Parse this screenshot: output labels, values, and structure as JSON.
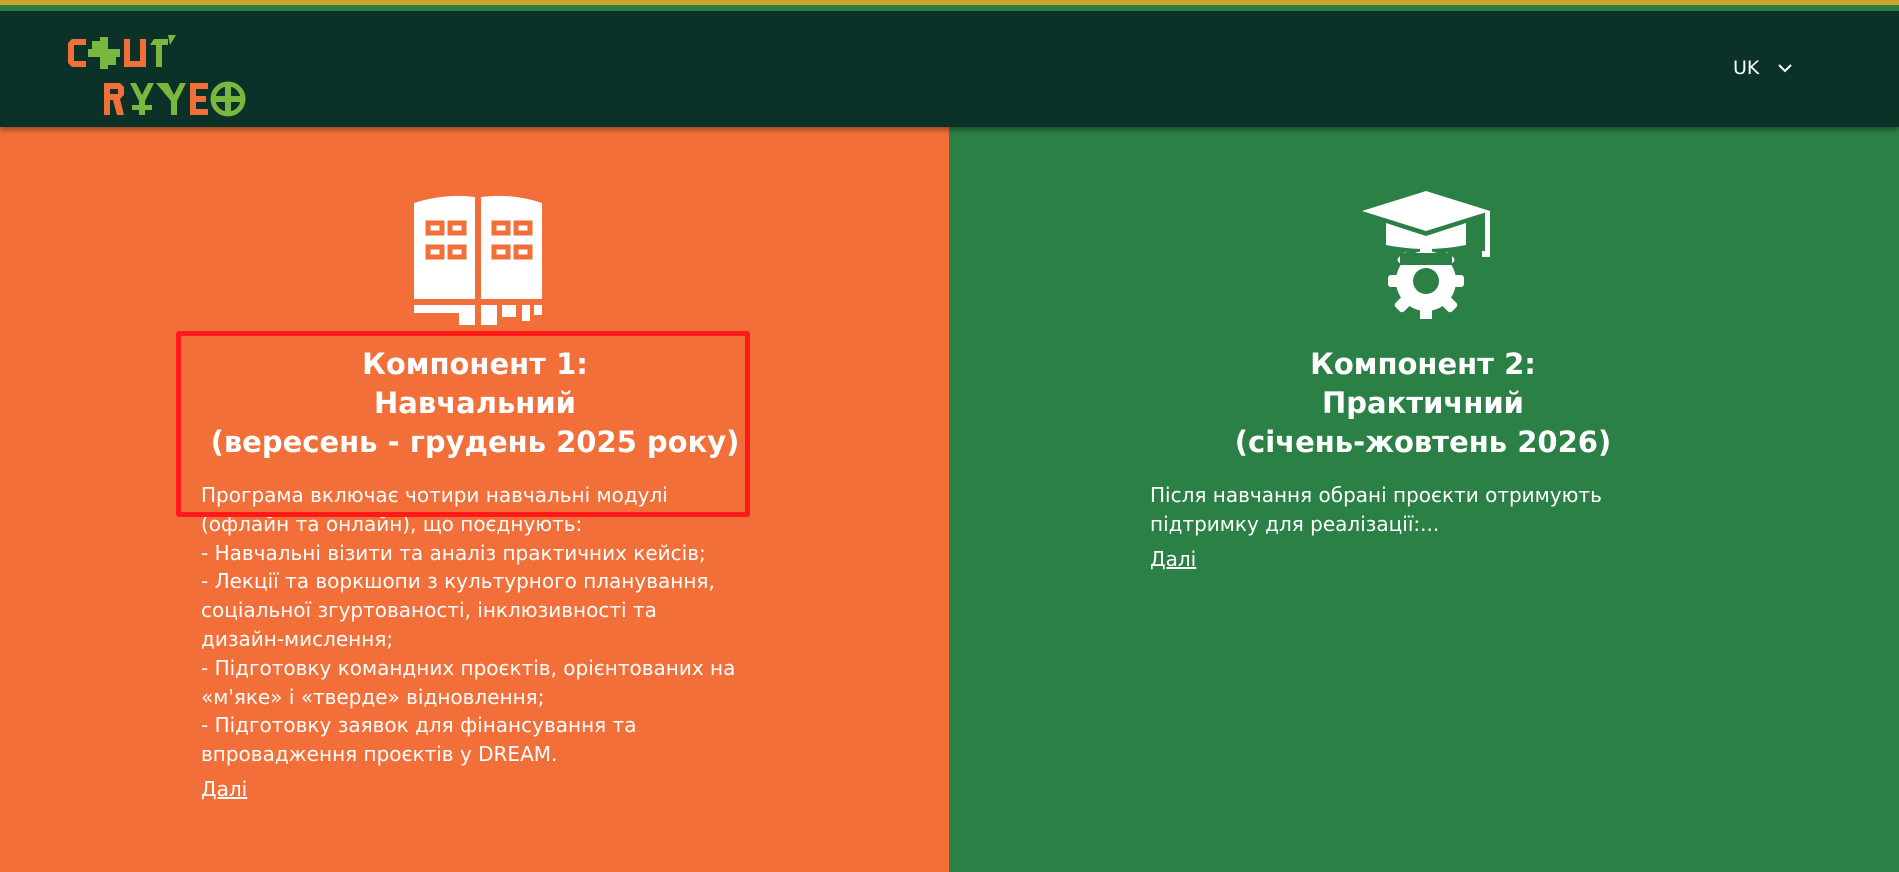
{
  "header": {
    "logo_icon": "cultureo-logo",
    "language": {
      "label": "UK",
      "icon": "chevron-down-icon"
    }
  },
  "components": [
    {
      "icon": "book-icon",
      "color": "#f26f3a",
      "title": "Компонент 1:\nНавчальний\n (вересень - грудень 2025 року)",
      "description": "Програма включає чотири навчальні модулі\n(офлайн та онлайн), що поєднують:\n- Навчальні візити та аналіз практичних кейсів;\n- Лекції та воркшопи з культурного планування,\nсоціальної згуртованості, інклюзивності та\nдизайн-мислення;\n- Підготовку командних проєктів, орієнтованих на\n«м'яке» і «тверде» відновлення;\n- Підготовку заявок для фінансування та\nвпровадження проєктів у DREAM.",
      "more_label": "Далі"
    },
    {
      "icon": "graduation-cap-gear-icon",
      "color": "#2b8046",
      "title": "Компонент 2:\nПрактичний\n(січень-жовтень 2026)",
      "description": "Після навчання обрані проєкти отримують\nпідтримку для реалізації:...",
      "more_label": "Далі"
    }
  ],
  "colors": {
    "header_bg": "#0c3129",
    "accent_orange": "#f26f3a",
    "accent_green": "#2b8046",
    "highlight_border": "#ff1a1a"
  }
}
